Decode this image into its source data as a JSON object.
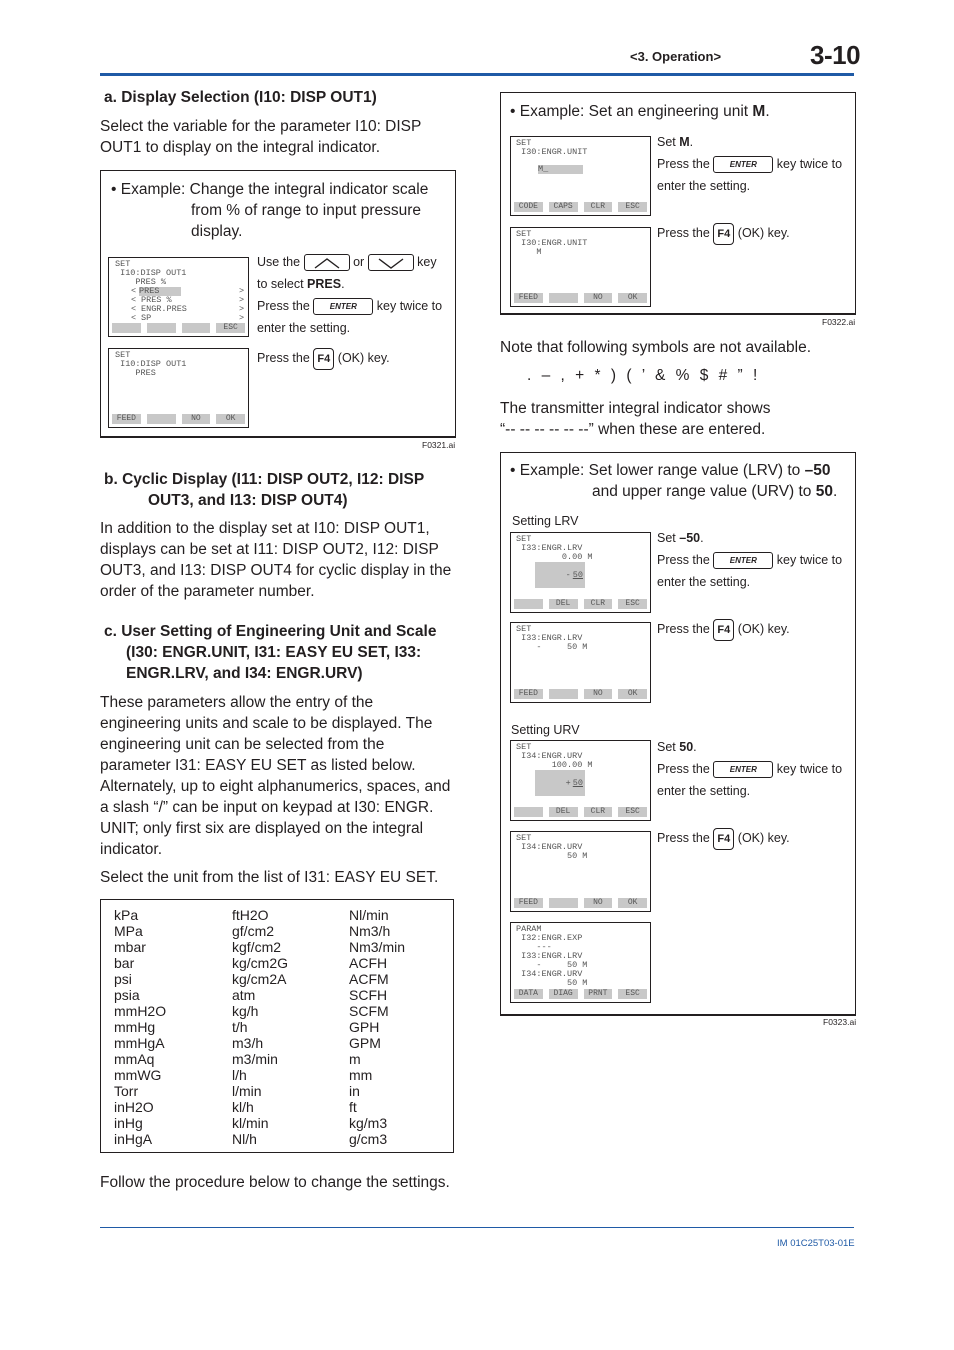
{
  "header": {
    "section": "<3. Operation>",
    "page": "3-10"
  },
  "sec_a": {
    "title": "a.  Display Selection (I10: DISP OUT1)",
    "body": "Select the variable for the parameter I10: DISP OUT1 to display on the integral indicator.",
    "example_line1": "• Example: Change the integral indicator scale",
    "example_line2": "from % of range to input pressure",
    "example_line3": "display.",
    "lcd1": {
      "lines": [
        "SET",
        " I10:DISP OUT1",
        "    PRES %"
      ],
      "options": [
        {
          "text": "PRES",
          "selected": true
        },
        {
          "text": "PRES %",
          "selected": false
        },
        {
          "text": "ENGR.PRES",
          "selected": false
        },
        {
          "text": "SP",
          "selected": false
        }
      ],
      "softkeys": [
        "",
        "",
        "",
        "ESC"
      ]
    },
    "lcd2": {
      "lines": [
        "SET",
        " I10:DISP OUT1",
        "    PRES"
      ],
      "softkeys": [
        "FEED",
        "",
        "NO",
        "OK"
      ]
    },
    "ins1": {
      "use_the": "Use the",
      "or": "or",
      "key": "key",
      "to_select": "to select ",
      "select_value": "PRES",
      "period": ".",
      "press_the": "Press the",
      "enter_key": "ENTER",
      "key_twice": "key twice to",
      "enter_setting": "enter the setting."
    },
    "ins2": {
      "press_the": "Press the",
      "f4_key": "F4",
      "ok_key": "(OK) key."
    },
    "fig": "F0321.ai"
  },
  "sec_b": {
    "title_line1": "b.  Cyclic Display (I11: DISP OUT2, I12: DISP",
    "title_line2": "OUT3, and I13: DISP OUT4)",
    "body": "In addition to the display set at I10: DISP OUT1, displays can be set at I11: DISP OUT2, I12: DISP OUT3, and I13: DISP OUT4 for cyclic display in the order of the parameter number."
  },
  "sec_c": {
    "title_line1": "c.  User Setting of Engineering Unit and Scale",
    "title_line2": "(I30: ENGR.UNIT, I31: EASY EU SET, I33:",
    "title_line3": "ENGR.LRV, and I34: ENGR.URV)",
    "body": "These parameters allow the entry of the engineering units and scale to be displayed. The engineering unit can be selected from the parameter I31: EASY EU SET as listed below. Alternately, up to eight alphanumerics, spaces, and a slash “/” can be input on keypad  at I30: ENGR. UNIT; only first six are displayed on the integral indicator.",
    "select_text": "Select the unit from the list of I31: EASY EU SET.",
    "units": [
      [
        "kPa",
        "MPa",
        "mbar",
        "bar",
        "psi",
        "psia",
        "mmH2O",
        "mmHg",
        "mmHgA",
        "mmAq",
        "mmWG",
        "Torr",
        "inH2O",
        "inHg",
        "inHgA"
      ],
      [
        "ftH2O",
        "gf/cm2",
        "kgf/cm2",
        "kg/cm2G",
        "kg/cm2A",
        "atm",
        "kg/h",
        "t/h",
        "m3/h",
        "m3/min",
        "l/h",
        "l/min",
        "kl/h",
        "kl/min",
        "Nl/h"
      ],
      [
        "Nl/min",
        "Nm3/h",
        "Nm3/min",
        "ACFH",
        "ACFM",
        "SCFH",
        "SCFM",
        "GPH",
        "GPM",
        "m",
        "mm",
        "in",
        "ft",
        "kg/m3",
        "g/cm3"
      ]
    ],
    "follow": "Follow the procedure below to change the settings."
  },
  "ex_unit": {
    "title_pre": "• Example: Set an engineering unit ",
    "title_bold": "M",
    "title_post": ".",
    "lcd1": {
      "lines": [
        "SET",
        " I30:ENGR.UNIT"
      ],
      "input": "M_",
      "softkeys": [
        "CODE",
        "CAPS",
        "CLR",
        "ESC"
      ]
    },
    "lcd2": {
      "lines": [
        "SET",
        " I30:ENGR.UNIT",
        "    M"
      ],
      "softkeys": [
        "FEED",
        "",
        "NO",
        "OK"
      ]
    },
    "ins1": {
      "set": "Set ",
      "set_value": "M",
      "period": ".",
      "press_the": "Press the",
      "enter_key": "ENTER",
      "key_twice": "key twice to",
      "enter_setting": "enter the setting."
    },
    "ins2": {
      "press_the": "Press the",
      "f4_key": "F4",
      "ok_key": "(OK) key."
    },
    "fig": "F0322.ai"
  },
  "note": {
    "text": "Note that following symbols are not available.",
    "symbols": ". – , + * ) ( ’ & % $ # ” !",
    "shows_line1": "The transmitter integral indicator shows",
    "shows_line2": "“-- -- -- -- -- --” when these are entered."
  },
  "ex_range": {
    "title_pre": "• Example: Set lower range value (LRV) to ",
    "title_bold1": "–50",
    "title_line2_pre": "and upper range value (URV) to ",
    "title_bold2": "50",
    "title_post": ".",
    "lrv_label": "Setting LRV",
    "urv_label": "Setting URV",
    "lcd_lrv1": {
      "lines": [
        "SET",
        " I33:ENGR.LRV",
        "         0.00 M"
      ],
      "input_sign": "-",
      "input_value": "50",
      "softkeys": [
        "",
        "DEL",
        "CLR",
        "ESC"
      ]
    },
    "lcd_lrv2": {
      "lines": [
        "SET",
        " I33:ENGR.LRV",
        "    -     50 M"
      ],
      "softkeys": [
        "FEED",
        "",
        "NO",
        "OK"
      ]
    },
    "lcd_urv1": {
      "lines": [
        "SET",
        " I34:ENGR.URV",
        "       100.00 M"
      ],
      "input_sign": "+",
      "input_value": "50",
      "softkeys": [
        "",
        "DEL",
        "CLR",
        "ESC"
      ]
    },
    "lcd_urv2": {
      "lines": [
        "SET",
        " I34:ENGR.URV",
        "          50 M"
      ],
      "softkeys": [
        "FEED",
        "",
        "NO",
        "OK"
      ]
    },
    "lcd_param": {
      "lines": [
        "PARAM",
        " I32:ENGR.EXP",
        "    ---",
        " I33:ENGR.LRV",
        "    -     50 M",
        " I34:ENGR.URV",
        "          50 M"
      ],
      "softkeys": [
        "DATA",
        "DIAG",
        "PRNT",
        "ESC"
      ]
    },
    "ins_lrv1": {
      "set": "Set ",
      "set_value": "–50",
      "period": ".",
      "press_the": "Press the",
      "enter_key": "ENTER",
      "key_twice": "key twice to",
      "enter_setting": "enter the setting."
    },
    "ins_lrv2": {
      "press_the": "Press the",
      "f4_key": "F4",
      "ok_key": "(OK) key."
    },
    "ins_urv1": {
      "set": "Set ",
      "set_value": "50",
      "period": ".",
      "press_the": "Press the",
      "enter_key": "ENTER",
      "key_twice": "key twice to",
      "enter_setting": "enter the setting."
    },
    "ins_urv2": {
      "press_the": "Press the",
      "f4_key": "F4",
      "ok_key": "(OK) key."
    },
    "fig": "F0323.ai"
  },
  "footer": {
    "doc_id": "IM 01C25T03-01E"
  }
}
